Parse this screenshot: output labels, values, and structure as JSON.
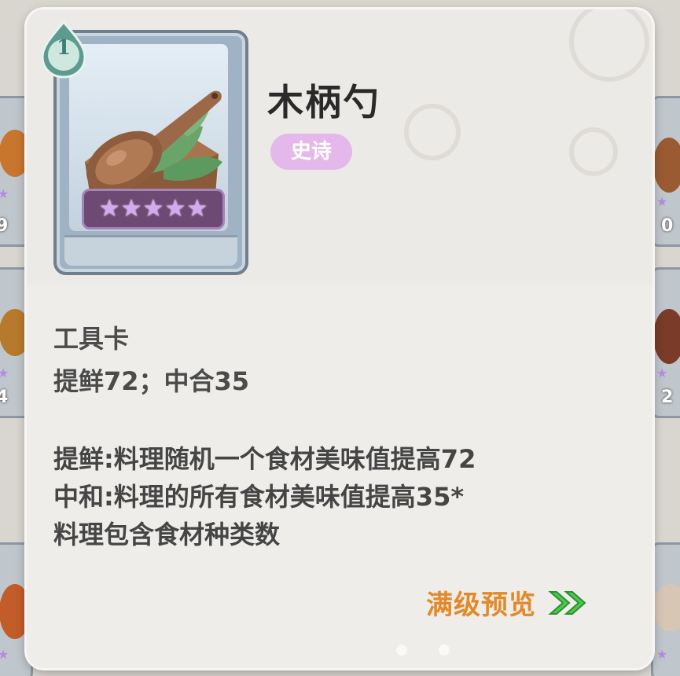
{
  "item": {
    "level": "1",
    "name": "木柄勺",
    "rarity": "史诗",
    "stars": [
      "★",
      "★",
      "★",
      "★",
      "★"
    ]
  },
  "details": {
    "card_type": "工具卡",
    "stats": "提鲜72；中合35",
    "description": [
      "提鲜:料理随机一个食材美味值提高72",
      "中和:料理的所有食材美味值提高35*",
      "料理包含食材种类数"
    ]
  },
  "actions": {
    "preview_label": "满级预览"
  },
  "background_cells": {
    "left_top_num": "9",
    "left_mid_num": "4",
    "right_top_num": "0",
    "right_mid_num": "2"
  },
  "colors": {
    "rarity_bg": "#e4b8ea",
    "preview_accent": "#e28a2a",
    "arrow_green": "#4cc84a",
    "star_purple": "#d4a9f0"
  },
  "icons": {
    "level_badge": "leaf-drop-badge",
    "preview_arrow": "double-chevron-right-icon",
    "card_art": "wooden-spoon-icon"
  }
}
